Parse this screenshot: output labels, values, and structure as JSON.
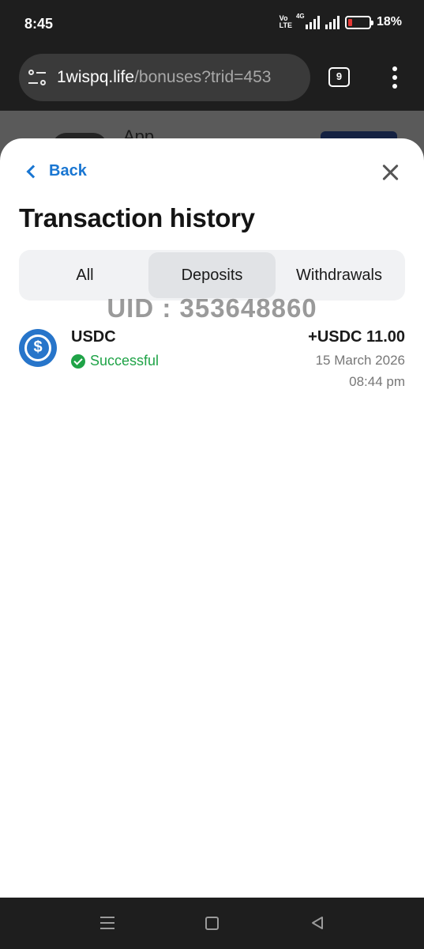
{
  "status_bar": {
    "time": "8:45",
    "volte_top": "Vo",
    "volte_bottom": "LTE",
    "network": "4G",
    "battery": "18%",
    "battery_level": 0.18
  },
  "browser": {
    "url_domain": "1wispq.life",
    "url_path": "/bonuses?trid=453",
    "tab_count": "9"
  },
  "behind": {
    "app_text": "App"
  },
  "sheet": {
    "back_label": "Back",
    "title": "Transaction history",
    "tabs": [
      {
        "label": "All",
        "active": false
      },
      {
        "label": "Deposits",
        "active": true
      },
      {
        "label": "Withdrawals",
        "active": false
      }
    ],
    "watermark": "UID : 353648860",
    "transactions": [
      {
        "currency": "USDC",
        "status": "Successful",
        "amount": "+USDC 11.00",
        "date": "15 March 2026",
        "time": "08:44 pm",
        "icon_symbol": "$"
      }
    ]
  },
  "colors": {
    "accent": "#1976d2",
    "success": "#1fa347",
    "usdc": "#2775ca"
  }
}
